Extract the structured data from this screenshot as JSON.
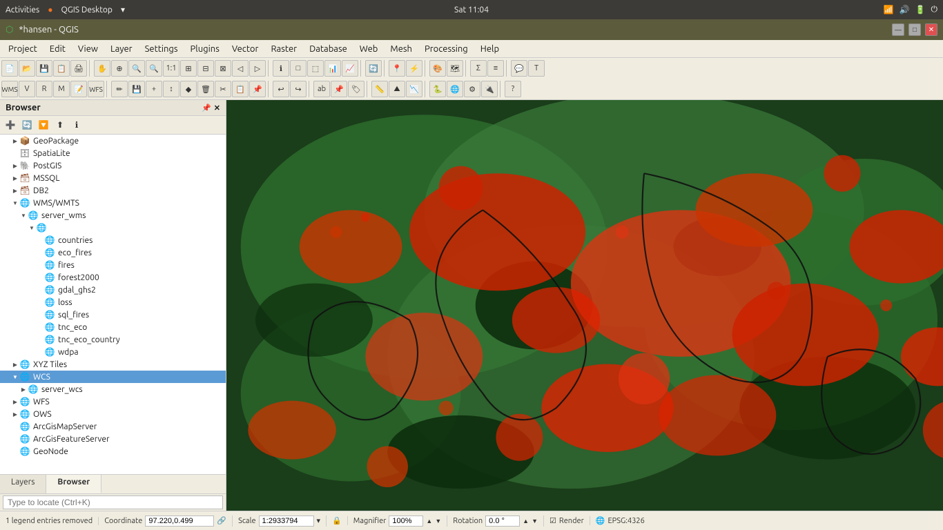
{
  "system_bar": {
    "activities": "Activities",
    "app_name": "QGIS Desktop",
    "time": "Sat 11:04",
    "window_controls": [
      "▼"
    ]
  },
  "title_bar": {
    "title": "*hansen - QGIS",
    "controls": [
      "—",
      "□",
      "✕"
    ]
  },
  "menu": {
    "items": [
      "Project",
      "Edit",
      "View",
      "Layer",
      "Settings",
      "Plugins",
      "Vector",
      "Raster",
      "Database",
      "Web",
      "Mesh",
      "Processing",
      "Help"
    ]
  },
  "browser_panel": {
    "title": "Browser",
    "tree_items": [
      {
        "id": "geopackage",
        "label": "GeoPackage",
        "indent": 1,
        "expanded": false,
        "icon": "📦",
        "selected": false
      },
      {
        "id": "spatialite",
        "label": "SpatiaLite",
        "indent": 1,
        "expanded": false,
        "icon": "🗄",
        "selected": false
      },
      {
        "id": "postgis",
        "label": "PostGIS",
        "indent": 1,
        "expanded": false,
        "icon": "🐘",
        "selected": false
      },
      {
        "id": "mssql",
        "label": "MSSQL",
        "indent": 1,
        "expanded": false,
        "icon": "🗃",
        "selected": false
      },
      {
        "id": "db2",
        "label": "DB2",
        "indent": 1,
        "expanded": false,
        "icon": "🗃",
        "selected": false
      },
      {
        "id": "wms_wmts",
        "label": "WMS/WMTS",
        "indent": 1,
        "expanded": true,
        "icon": "🌐",
        "selected": false
      },
      {
        "id": "server_wms",
        "label": "server_wms",
        "indent": 2,
        "expanded": true,
        "icon": "🌐",
        "selected": false
      },
      {
        "id": "globe_sub",
        "label": "",
        "indent": 3,
        "expanded": true,
        "icon": "🌐",
        "selected": false
      },
      {
        "id": "countries",
        "label": "countries",
        "indent": 4,
        "expanded": false,
        "icon": "🌐",
        "selected": false
      },
      {
        "id": "eco_fires",
        "label": "eco_fires",
        "indent": 4,
        "expanded": false,
        "icon": "🌐",
        "selected": false
      },
      {
        "id": "fires",
        "label": "fires",
        "indent": 4,
        "expanded": false,
        "icon": "🌐",
        "selected": false
      },
      {
        "id": "forest2000",
        "label": "forest2000",
        "indent": 4,
        "expanded": false,
        "icon": "🌐",
        "selected": false
      },
      {
        "id": "gdal_ghs2",
        "label": "gdal_ghs2",
        "indent": 4,
        "expanded": false,
        "icon": "🌐",
        "selected": false
      },
      {
        "id": "loss",
        "label": "loss",
        "indent": 4,
        "expanded": false,
        "icon": "🌐",
        "selected": false
      },
      {
        "id": "sql_fires",
        "label": "sql_fires",
        "indent": 4,
        "expanded": false,
        "icon": "🌐",
        "selected": false
      },
      {
        "id": "tnc_eco",
        "label": "tnc_eco",
        "indent": 4,
        "expanded": false,
        "icon": "🌐",
        "selected": false
      },
      {
        "id": "tnc_eco_country",
        "label": "tnc_eco_country",
        "indent": 4,
        "expanded": false,
        "icon": "🌐",
        "selected": false
      },
      {
        "id": "wdpa",
        "label": "wdpa",
        "indent": 4,
        "expanded": false,
        "icon": "🌐",
        "selected": false
      },
      {
        "id": "xyz_tiles",
        "label": "XYZ Tiles",
        "indent": 1,
        "expanded": false,
        "icon": "🌐",
        "selected": false
      },
      {
        "id": "wcs",
        "label": "WCS",
        "indent": 1,
        "expanded": true,
        "icon": "🌐",
        "selected": true
      },
      {
        "id": "server_wcs",
        "label": "server_wcs",
        "indent": 2,
        "expanded": false,
        "icon": "🌐",
        "selected": false
      },
      {
        "id": "wfs",
        "label": "WFS",
        "indent": 1,
        "expanded": false,
        "icon": "🌐",
        "selected": false
      },
      {
        "id": "ows",
        "label": "OWS",
        "indent": 1,
        "expanded": false,
        "icon": "🌐",
        "selected": false
      },
      {
        "id": "arcgismapserver",
        "label": "ArcGisMapServer",
        "indent": 1,
        "expanded": false,
        "icon": "🌐",
        "selected": false
      },
      {
        "id": "arcgisfeatureserver",
        "label": "ArcGisFeatureServer",
        "indent": 1,
        "expanded": false,
        "icon": "🌐",
        "selected": false
      },
      {
        "id": "geonode",
        "label": "GeoNode",
        "indent": 1,
        "expanded": false,
        "icon": "🌐",
        "selected": false
      }
    ]
  },
  "bottom_tabs": [
    {
      "label": "Layers",
      "active": false
    },
    {
      "label": "Browser",
      "active": true
    }
  ],
  "locate_bar": {
    "placeholder": "Type to locate (Ctrl+K)"
  },
  "status_bar": {
    "legend_msg": "1 legend entries removed",
    "coordinate_label": "Coordinate",
    "coordinate_value": "97.220,0.499",
    "scale_label": "Scale",
    "scale_value": "1:2933794",
    "magnifier_label": "Magnifier",
    "magnifier_value": "100%",
    "rotation_label": "Rotation",
    "rotation_value": "0.0 °",
    "render_label": "Render",
    "epsg_value": "EPSG:4326"
  }
}
